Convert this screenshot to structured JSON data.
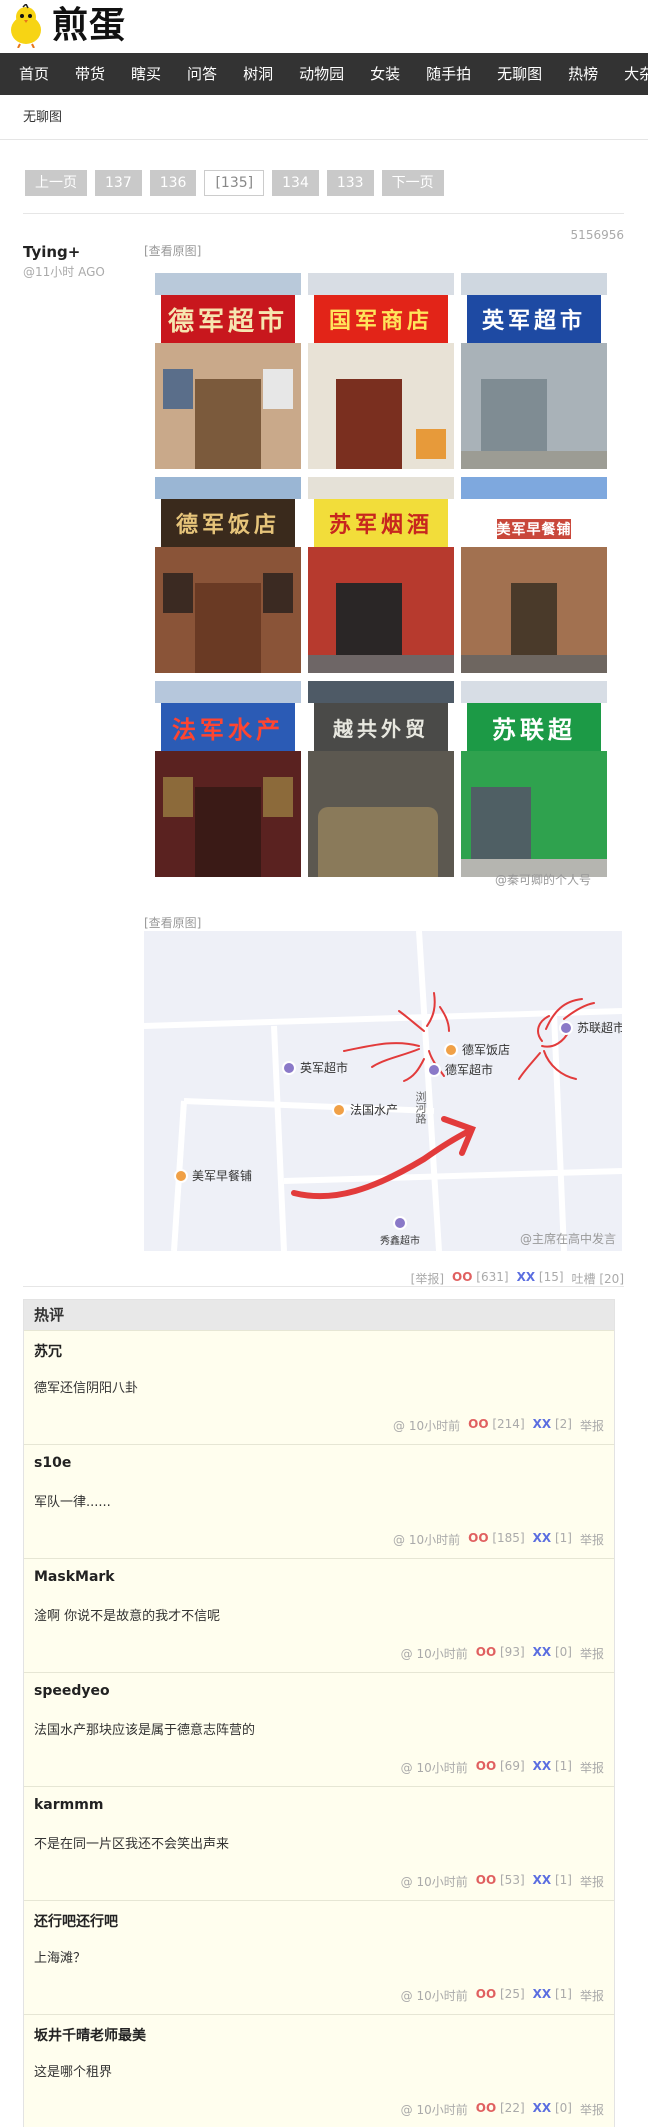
{
  "logo": {
    "text": "煎蛋"
  },
  "nav": [
    "首页",
    "带货",
    "瞎买",
    "问答",
    "树洞",
    "动物园",
    "女装",
    "随手拍",
    "无聊图",
    "热榜",
    "大杂烩"
  ],
  "breadcrumb": "无聊图",
  "pager": {
    "prev": "上一页",
    "pages": [
      "137",
      "136",
      "[135]",
      "134",
      "133"
    ],
    "next": "下一页"
  },
  "post": {
    "id": "5156956",
    "author": "Tying+",
    "time": "@11小时 AGO",
    "view_original_1": "[查看原图]",
    "view_original_2": "[查看原图]",
    "collage_signs": [
      "德军超市",
      "国军商店",
      "英军超市",
      "德军饭店",
      "苏军烟酒",
      "美军早餐铺",
      "法军水产",
      "越共外贸",
      "苏联超"
    ],
    "collage_watermark": "@秦可卿的个人号",
    "map": {
      "pois": [
        "德军饭店",
        "苏联超市",
        "英军超市",
        "德军超市",
        "法国水产",
        "美军早餐铺",
        "秀鑫超市"
      ],
      "street": "浏河路",
      "watermark": "@主席在高中发言"
    },
    "actions": {
      "report": "[举报]",
      "oo_label": "OO",
      "oo_count": "[631]",
      "xx_label": "XX",
      "xx_count": "[15]",
      "tucao": "吐槽 [20]"
    }
  },
  "hot": {
    "title": "热评",
    "comments": [
      {
        "author": "苏冗",
        "text": "德军还信阴阳八卦",
        "time": "@ 10小时前",
        "oo": "[214]",
        "xx": "[2]"
      },
      {
        "author": "s10e",
        "text": "军队一律......",
        "time": "@ 10小时前",
        "oo": "[185]",
        "xx": "[1]"
      },
      {
        "author": "MaskMark",
        "text": "淦啊 你说不是故意的我才不信呢",
        "time": "@ 10小时前",
        "oo": "[93]",
        "xx": "[0]"
      },
      {
        "author": "speedyeo",
        "text": "法国水产那块应该是属于德意志阵营的",
        "time": "@ 10小时前",
        "oo": "[69]",
        "xx": "[1]"
      },
      {
        "author": "karmmm",
        "text": "不是在同一片区我还不会笑出声来",
        "time": "@ 10小时前",
        "oo": "[53]",
        "xx": "[1]"
      },
      {
        "author": "还行吧还行吧",
        "text": "上海滩？",
        "time": "@ 10小时前",
        "oo": "[25]",
        "xx": "[1]"
      },
      {
        "author": "坂井千晴老师最美",
        "text": "这是哪个租界",
        "time": "@ 10小时前",
        "oo": "[22]",
        "xx": "[0]"
      }
    ],
    "oo_label": "OO",
    "xx_label": "XX",
    "report": "举报"
  },
  "colors": {
    "nav_bg": "#333333",
    "comment_bg": "#fffeee",
    "oo": "#e06060",
    "xx": "#5b6ee0"
  }
}
